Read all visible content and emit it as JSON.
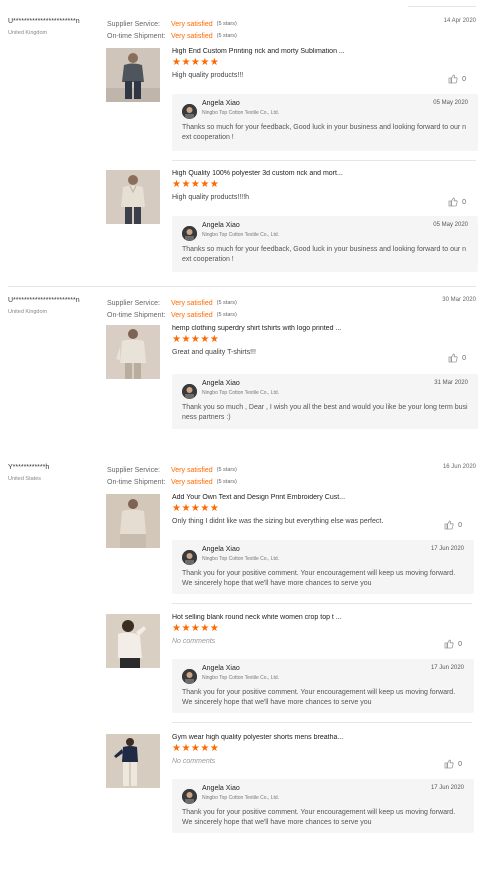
{
  "labels": {
    "supplier_service": "Supplier Service:",
    "ontime_shipment": "On-time Shipment:"
  },
  "colors": {
    "accent": "#ff6a00"
  },
  "reviews": [
    {
      "reviewer": "U***********************n",
      "country": "United Kingdom",
      "date": "14 Apr 2020",
      "supplier_service": "Very satisfied",
      "supplier_service_stars": "(5 stars)",
      "ontime_shipment": "Very satisfied",
      "ontime_shipment_stars": "(5 stars)",
      "products": [
        {
          "title": "High End Custom Printing rick and morty Sublimation ...",
          "rating": 5,
          "comment": "High quality products!!!",
          "likes": "0",
          "reply": {
            "name": "Angela Xiao",
            "company": "Ningbo Top Cotton Textile Co., Ltd.",
            "date": "05 May 2020",
            "text": "Thanks so much for your feedback, Good luck in your business and looking forward to our next cooperation !"
          }
        },
        {
          "title": "High Quality 100% polyester 3d custom rick and mort...",
          "rating": 5,
          "comment": "High quality products!!!!h",
          "likes": "0",
          "reply": {
            "name": "Angela Xiao",
            "company": "Ningbo Top Cotton Textile Co., Ltd.",
            "date": "05 May 2020",
            "text": "Thanks so much for your feedback, Good luck in your business and looking forward to our next cooperation !"
          }
        }
      ]
    },
    {
      "reviewer": "U***********************n",
      "country": "United Kingdom",
      "date": "30 Mar 2020",
      "supplier_service": "Very satisfied",
      "supplier_service_stars": "(5 stars)",
      "ontime_shipment": "Very satisfied",
      "ontime_shipment_stars": "(5 stars)",
      "products": [
        {
          "title": "hemp clothing superdry shirt tshirts with logo printed ...",
          "rating": 5,
          "comment": "Great and quality T-shirts!!!",
          "likes": "0",
          "reply": {
            "name": "Angela Xiao",
            "company": "Ningbo Top Cotton Textile Co., Ltd.",
            "date": "31 Mar 2020",
            "text": "Thank you so much , Dear , I wish you all the best and would you like be your long term business partners :)"
          }
        }
      ]
    },
    {
      "reviewer": "Y************h",
      "country": "United States",
      "date": "16 Jun 2020",
      "supplier_service": "Very satisfied",
      "supplier_service_stars": "(5 stars)",
      "ontime_shipment": "Very satisfied",
      "ontime_shipment_stars": "(5 stars)",
      "products": [
        {
          "title": "Add Your Own Text and Design Print Embroidery Cust...",
          "rating": 5,
          "comment": "Only thing I didnt like was the sizing but everything else was perfect.",
          "likes": "0",
          "reply": {
            "name": "Angela Xiao",
            "company": "Ningbo Top Cotton Textile Co., Ltd.",
            "date": "17 Jun 2020",
            "text": "Thank you for your positive comment. Your encouragement will keep us moving forward. We sincerely hope that we'll have more chances to serve you"
          }
        },
        {
          "title": "Hot selling blank round neck white women crop top t ...",
          "rating": 5,
          "comment": "No comments",
          "likes": "0",
          "reply": {
            "name": "Angela Xiao",
            "company": "Ningbo Top Cotton Textile Co., Ltd.",
            "date": "17 Jun 2020",
            "text": "Thank you for your positive comment. Your encouragement will keep us moving forward. We sincerely hope that we'll have more chances to serve you"
          }
        },
        {
          "title": "Gym wear high quality polyester shorts mens breatha...",
          "rating": 5,
          "comment": "No comments",
          "likes": "0",
          "reply": {
            "name": "Angela Xiao",
            "company": "Ningbo Top Cotton Textile Co., Ltd.",
            "date": "17 Jun 2020",
            "text": "Thank you for your positive comment. Your encouragement will keep us moving forward. We sincerely hope that we'll have more chances to serve you"
          }
        }
      ]
    }
  ]
}
